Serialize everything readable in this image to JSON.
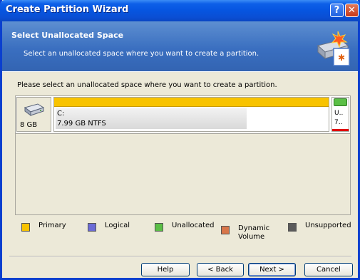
{
  "window": {
    "title": "Create Partition Wizard",
    "help_glyph": "?",
    "close_glyph": "✕"
  },
  "header": {
    "title": "Select Unallocated Space",
    "subtitle": "Select an unallocated space where you want to create a partition."
  },
  "content": {
    "instruction": "Please select an unallocated space where you want to create a partition.",
    "disk": {
      "size_label": "8 GB",
      "partitions": [
        {
          "name": "C:",
          "info": "7.99 GB  NTFS",
          "color": "#f8c300"
        },
        {
          "name": "U..",
          "info": "7..",
          "color": "#5bbf46",
          "selected": true
        }
      ]
    }
  },
  "legend": [
    {
      "label": "Primary",
      "color": "#f8c300"
    },
    {
      "label": "Logical",
      "color": "#6b6bd6"
    },
    {
      "label": "Unallocated",
      "color": "#5bbf46"
    },
    {
      "label": "Dynamic Volume",
      "color": "#d8764a"
    },
    {
      "label": "Unsupported",
      "color": "#5a5a5a"
    }
  ],
  "buttons": {
    "help": "Help",
    "back": "< Back",
    "next": "Next >",
    "cancel": "Cancel"
  }
}
